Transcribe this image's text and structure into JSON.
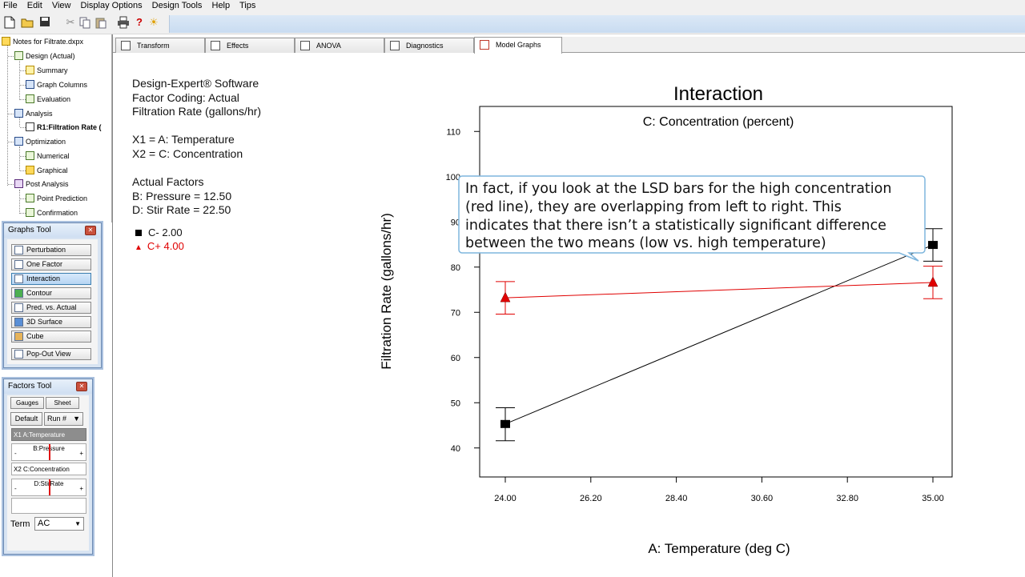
{
  "menu": [
    "File",
    "Edit",
    "View",
    "Display Options",
    "Design Tools",
    "Help",
    "Tips"
  ],
  "toolbar_icons": [
    "new-icon",
    "open-icon",
    "save-icon",
    "cut-icon",
    "copy-icon",
    "paste-icon",
    "print-icon",
    "help-icon",
    "tip-icon"
  ],
  "tree": {
    "root": "Notes for Filtrate.dxpx",
    "design": "Design (Actual)",
    "summary": "Summary",
    "graph_columns": "Graph Columns",
    "evaluation": "Evaluation",
    "analysis": "Analysis",
    "r1": "R1:Filtration Rate (",
    "optimization": "Optimization",
    "numerical": "Numerical",
    "graphical": "Graphical",
    "post_analysis": "Post Analysis",
    "point_prediction": "Point Prediction",
    "confirmation": "Confirmation"
  },
  "graphs_tool": {
    "title": "Graphs Tool",
    "buttons": [
      "Perturbation",
      "One Factor",
      "Interaction",
      "Contour",
      "Pred. vs. Actual",
      "3D Surface",
      "Cube",
      "Pop-Out View"
    ],
    "selected": "Interaction"
  },
  "factors_tool": {
    "title": "Factors Tool",
    "tab_gauges": "Gauges",
    "tab_sheet": "Sheet",
    "default_btn": "Default",
    "run_select": "Run #",
    "x1_row": "X1 A:Temperature",
    "b_slider": "B:Pressure",
    "x2_row": "X2 C:Concentration",
    "d_slider": "D:StirRate",
    "minus": "-",
    "plus": "+",
    "term_label": "Term",
    "term_value": "AC"
  },
  "tabs": [
    "Transform",
    "Effects",
    "ANOVA",
    "Diagnostics",
    "Model Graphs"
  ],
  "active_tab": "Model Graphs",
  "notes": {
    "software": "Design-Expert® Software",
    "coding": "Factor Coding: Actual",
    "response": "Filtration Rate (gallons/hr)",
    "x1": "X1 = A: Temperature",
    "x2": "X2 = C: Concentration",
    "actual_factors": "Actual Factors",
    "b": "B: Pressure = 12.50",
    "d": "D: Stir Rate = 22.50",
    "legend_low": "C- 2.00",
    "legend_high": "C+ 4.00"
  },
  "callout": {
    "lines": [
      "In fact, if you look at the LSD bars for the high concentration",
      "(red line), they are overlapping from left to right.  This",
      "indicates that there isn’t a statistically significant difference",
      "between the two means (low vs. high temperature)"
    ]
  },
  "chart_data": {
    "type": "line",
    "title": "Interaction",
    "subtitle": "C: Concentration (percent)",
    "xlabel": "A: Temperature (deg C)",
    "ylabel": "Filtration Rate (gallons/hr)",
    "xlim": [
      24.0,
      35.0
    ],
    "ylim": [
      35.0,
      115.0
    ],
    "x_ticks": [
      "24.00",
      "26.20",
      "28.40",
      "30.60",
      "32.80",
      "35.00"
    ],
    "y_ticks": [
      "40",
      "50",
      "60",
      "70",
      "80",
      "90",
      "100",
      "110"
    ],
    "series": [
      {
        "name": "C- 2.00",
        "color": "#000000",
        "marker": "square",
        "x": [
          24.0,
          35.0
        ],
        "y": [
          45.3,
          84.9
        ],
        "lsd_low": [
          41.6,
          81.3
        ],
        "lsd_high": [
          48.9,
          88.5
        ]
      },
      {
        "name": "C+ 4.00",
        "color": "#e00000",
        "marker": "triangle",
        "x": [
          24.0,
          35.0
        ],
        "y": [
          73.2,
          76.6
        ],
        "lsd_low": [
          69.6,
          73.0
        ],
        "lsd_high": [
          76.8,
          80.2
        ]
      }
    ]
  }
}
